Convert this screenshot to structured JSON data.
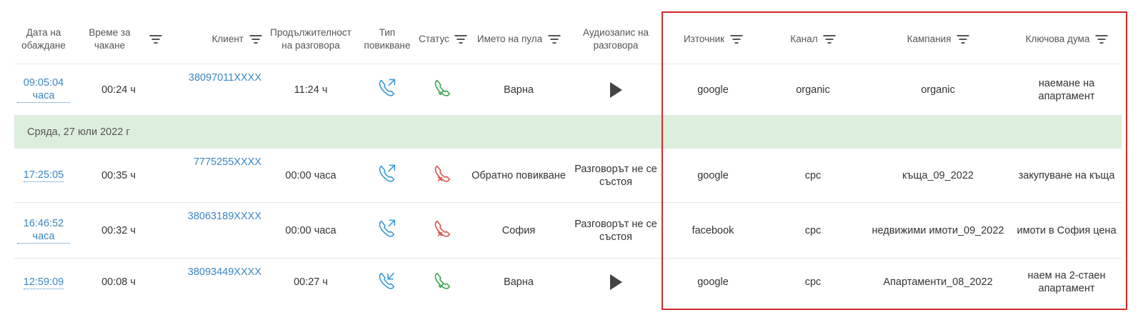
{
  "headers": {
    "date": "Дата на обаждане",
    "wait": "Време за чакане",
    "client": "Клиент",
    "duration": "Продължителност на разговора",
    "type": "Тип повикване",
    "status": "Статус",
    "pool": "Името на пула",
    "audio": "Аудиозапис на разговора",
    "source": "Източник",
    "channel": "Канал",
    "campaign": "Кампания",
    "keyword": "Ключова дума"
  },
  "rows_top": [
    {
      "date": "09:05:04 часа",
      "wait": "00:24 ч",
      "client": "38097011XXXX",
      "duration": "11:24 ч",
      "type_icon": "outgoing-call-icon",
      "status_icon": "call-answered-icon",
      "pool": "Варна",
      "audio": "",
      "source": "google",
      "channel": "organic",
      "campaign": "organic",
      "keyword": "наемане на апартамент"
    }
  ],
  "group_label": "Сряда, 27 юли 2022 г",
  "rows": [
    {
      "date": "17:25:05",
      "wait": "00:35 ч",
      "client": "7775255XXXX",
      "duration": "00:00 часа",
      "type_icon": "outgoing-call-icon",
      "status_icon": "call-failed-icon",
      "pool": "Обратно повикване",
      "audio": "Разговорът не се състоя",
      "source": "google",
      "channel": "cpc",
      "campaign": "къща_09_2022",
      "keyword": "закупуване на къща"
    },
    {
      "date": "16:46:52 часа",
      "wait": "00:32 ч",
      "client": "38063189XXXX",
      "duration": "00:00 часа",
      "type_icon": "outgoing-call-icon",
      "status_icon": "call-failed-icon",
      "pool": "София",
      "audio": "Разговорът не се състоя",
      "source": "facebook",
      "channel": "cpc",
      "campaign": "недвижими имоти_09_2022",
      "keyword": "имоти в София цена"
    },
    {
      "date": "12:59:09",
      "wait": "00:08 ч",
      "client": "38093449XXXX",
      "duration": "00:27 ч",
      "type_icon": "incoming-call-icon",
      "status_icon": "call-answered-icon",
      "pool": "Варна",
      "audio": "",
      "source": "google",
      "channel": "cpc",
      "campaign": "Апартаменти_08_2022",
      "keyword": "наем на 2-стаен апартамент"
    }
  ],
  "colors": {
    "link": "#3b86c4",
    "group_bg": "#dcefdc",
    "answered": "#3aa655",
    "failed": "#d9534f",
    "call_type": "#3b9ad8",
    "highlight": "#d42a2a"
  }
}
